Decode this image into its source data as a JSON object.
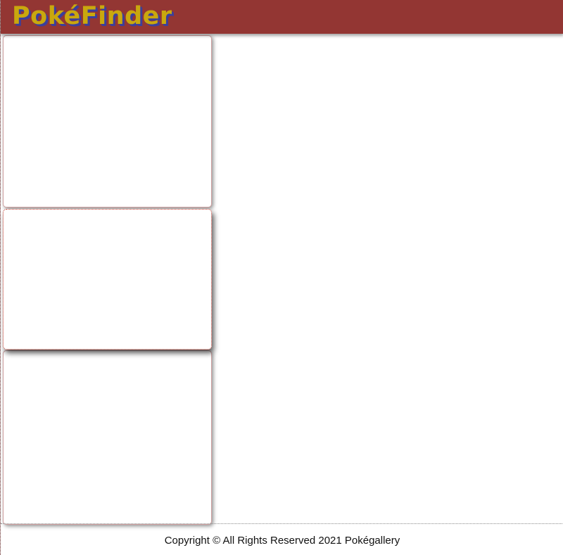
{
  "header": {
    "logo_text": "PokéFinder"
  },
  "cards": [
    {
      "label": ""
    },
    {
      "label": ""
    },
    {
      "label": ""
    }
  ],
  "footer": {
    "copyright": "Copyright © All Rights Reserved 2021 Pokégallery"
  },
  "colors": {
    "header_background": "#933633",
    "logo_fill": "#c9a80e",
    "logo_shadow": "#3b3f9c",
    "card_border": "#c0392b"
  }
}
